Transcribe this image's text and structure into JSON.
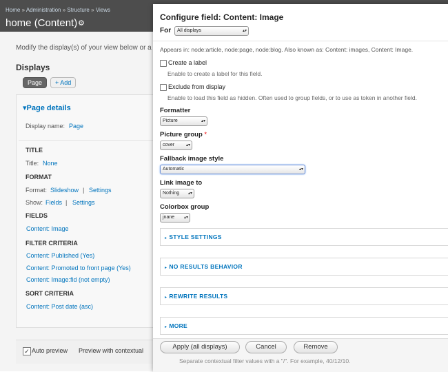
{
  "background": {
    "breadcrumb": [
      "Home",
      "Administration",
      "Structure",
      "Views"
    ],
    "breadcrumb_sep": "»",
    "page_title": "home (Content)",
    "gear_glyph": "⚙",
    "description": "Modify the display(s) of your view below or a",
    "displays_heading": "Displays",
    "tabs": {
      "page": "Page",
      "add": "+ Add"
    },
    "page_details": "▾Page details",
    "display_name_label": "Display name:",
    "display_name_value": "Page",
    "title_section": "TITLE",
    "title_label": "Title:",
    "title_value": "None",
    "format_section": "FORMAT",
    "format_label": "Format:",
    "format_value": "Slideshow",
    "format_settings": "Settings",
    "show_label": "Show:",
    "show_value": "Fields",
    "show_settings": "Settings",
    "pipe": "|",
    "fields_section": "FIELDS",
    "fields": [
      "Content: Image"
    ],
    "filter_section": "FILTER CRITERIA",
    "filters": [
      "Content: Published (Yes)",
      "Content: Promoted to front page (Yes)",
      "Content: Image:fid (not empty)"
    ],
    "sort_section": "SORT CRITERIA",
    "sorts": [
      "Content: Post date (asc)"
    ],
    "auto_preview_check": "✓",
    "auto_preview_label": "Auto preview",
    "preview_label": "Preview with contextual"
  },
  "modal": {
    "title": "Configure field: Content: Image",
    "for_label": "For",
    "for_value": "All displays",
    "appears_in": "Appears in: node:article, node:page, node:blog. Also known as: Content: images, Content: Image.",
    "create_label": {
      "label": "Create a label",
      "help": "Enable to create a label for this field.",
      "checked": false
    },
    "exclude": {
      "label": "Exclude from display",
      "help": "Enable to load this field as hidden. Often used to group fields, or to use as token in another field.",
      "checked": false
    },
    "formatter": {
      "label": "Formatter",
      "value": "Picture"
    },
    "picture_group": {
      "label": "Picture group",
      "required": "*",
      "value": "cover"
    },
    "fallback": {
      "label": "Fallback image style",
      "value": "Automatic"
    },
    "link_image": {
      "label": "Link image to",
      "value": "Nothing"
    },
    "colorbox": {
      "label": "Colorbox group",
      "value": "jnane"
    },
    "select_arrow": "▴▾",
    "fieldset_glyph": "▸",
    "fieldsets": [
      "STYLE SETTINGS",
      "NO RESULTS BEHAVIOR",
      "REWRITE RESULTS",
      "MORE"
    ],
    "buttons": {
      "apply": "Apply (all displays)",
      "cancel": "Cancel",
      "remove": "Remove"
    },
    "separator_note": "Separate contextual filter values with a \"/\". For example, 40/12/10."
  }
}
